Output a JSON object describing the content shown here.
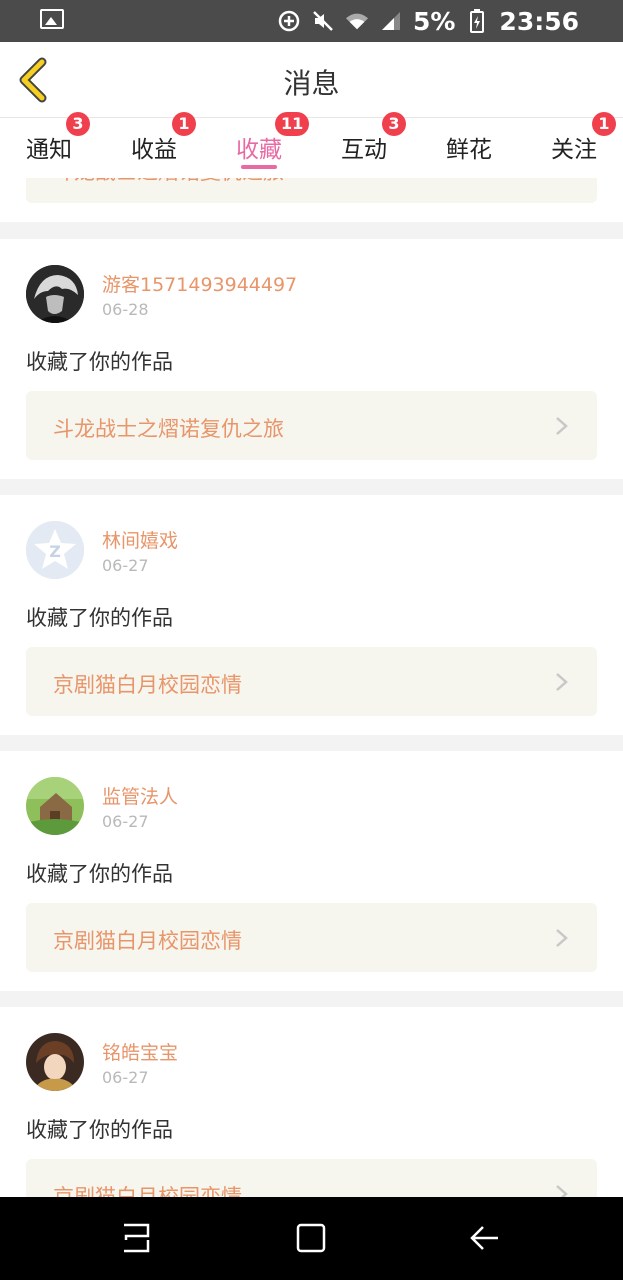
{
  "status_bar": {
    "battery_percent": "5%",
    "time": "23:56",
    "icons": [
      "image-icon",
      "data-saver-icon",
      "mute-icon",
      "wifi-icon",
      "signal-icon",
      "battery-icon"
    ]
  },
  "header": {
    "title": "消息",
    "back_icon": "chevron-left-icon",
    "accent": "#f5d020"
  },
  "tabs": [
    {
      "label": "通知",
      "badge": "3"
    },
    {
      "label": "收益",
      "badge": "1"
    },
    {
      "label": "收藏",
      "badge": "11",
      "active": true
    },
    {
      "label": "互动",
      "badge": "3"
    },
    {
      "label": "鲜花",
      "badge": ""
    },
    {
      "label": "关注",
      "badge": "1"
    }
  ],
  "partial_top_card": {
    "work_title": "斗龙战士之熠诺复仇之旅"
  },
  "items": [
    {
      "user": "游客1571493944497",
      "date": "06-28",
      "action": "收藏了你的作品",
      "work": "斗龙战士之熠诺复仇之旅",
      "avatar": "avatar-dark-hair"
    },
    {
      "user": "林间嬉戏",
      "date": "06-27",
      "action": "收藏了你的作品",
      "work": "京剧猫白月校园恋情",
      "avatar": "avatar-default-star"
    },
    {
      "user": "监管法人",
      "date": "06-27",
      "action": "收藏了你的作品",
      "work": "京剧猫白月校园恋情",
      "avatar": "avatar-landscape"
    },
    {
      "user": "铭皓宝宝",
      "date": "06-27",
      "action": "收藏了你的作品",
      "work": "京剧猫白月校园恋情",
      "avatar": "avatar-anime"
    }
  ],
  "colors": {
    "accent_pink": "#e86aa5",
    "badge_red": "#f0404e",
    "name_orange": "#e8956a",
    "work_bg": "#f6f5ee"
  },
  "nav_bar": {
    "buttons": [
      "recent-apps-icon",
      "home-icon",
      "back-icon"
    ]
  }
}
